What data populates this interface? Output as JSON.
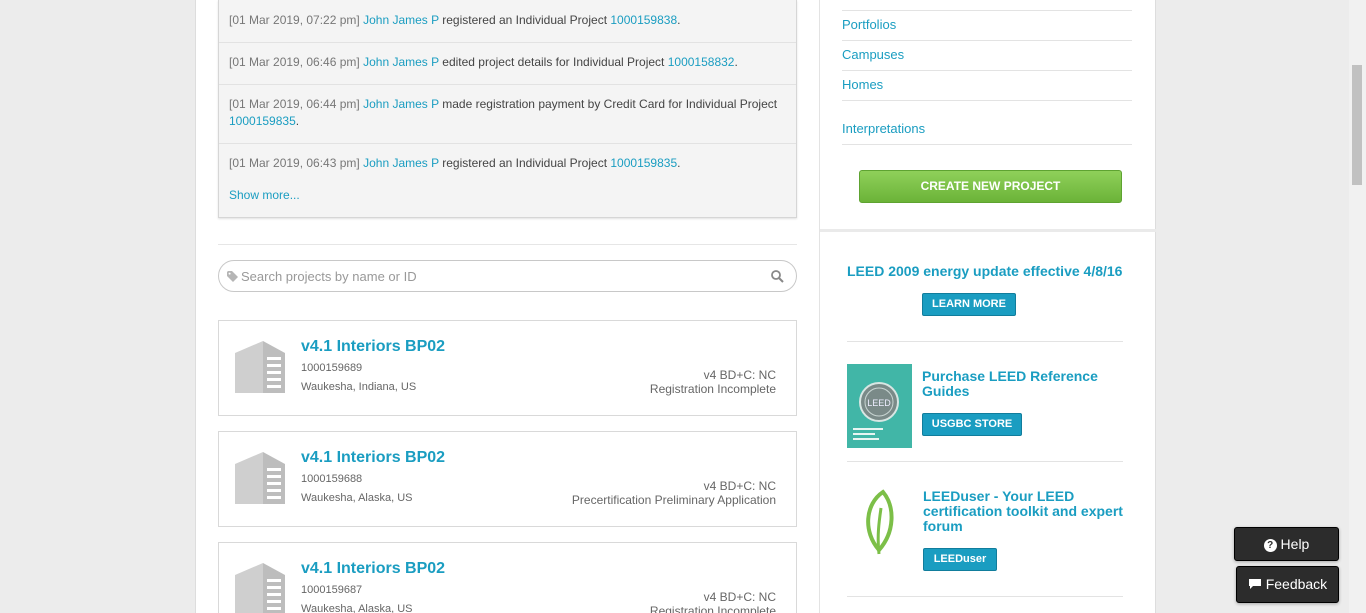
{
  "activity": {
    "items": [
      {
        "date": "[01 Mar 2019, 07:22 pm]",
        "user": "John James P",
        "action": "registered an Individual Project",
        "project": "1000159838",
        "suffix": "."
      },
      {
        "date": "[01 Mar 2019, 06:46 pm]",
        "user": "John James P",
        "action": "edited project details for Individual Project",
        "project": "1000158832",
        "suffix": "."
      },
      {
        "date": "[01 Mar 2019, 06:44 pm]",
        "user": "John James P",
        "action": "made registration payment by Credit Card for Individual Project",
        "project": "1000159835",
        "suffix": "."
      },
      {
        "date": "[01 Mar 2019, 06:43 pm]",
        "user": "John James P",
        "action": "registered an Individual Project",
        "project": "1000159835",
        "suffix": "."
      }
    ],
    "show_more": "Show more..."
  },
  "search": {
    "placeholder": "Search projects by name or ID"
  },
  "projects": [
    {
      "name": "v4.1 Interiors BP02",
      "id": "1000159689",
      "location": "Waukesha, Indiana, US",
      "rating": "v4 BD+C: NC",
      "status": "Registration Incomplete"
    },
    {
      "name": "v4.1 Interiors BP02",
      "id": "1000159688",
      "location": "Waukesha, Alaska, US",
      "rating": "v4 BD+C: NC",
      "status": "Precertification Preliminary Application"
    },
    {
      "name": "v4.1 Interiors BP02",
      "id": "1000159687",
      "location": "Waukesha, Alaska, US",
      "rating": "v4 BD+C: NC",
      "status": "Registration Incomplete"
    }
  ],
  "sidebar": {
    "links": [
      "Portfolios",
      "Campuses",
      "Homes",
      "Interpretations"
    ],
    "create_button": "CREATE NEW PROJECT",
    "promos": {
      "energy_title": "LEED 2009 energy update effective 4/8/16",
      "energy_button": "LEARN MORE",
      "guides_title": "Purchase LEED Reference Guides",
      "guides_button": "USGBC STORE",
      "book_text": "LEED",
      "leeduser_title": "LEEDuser - Your LEED certification toolkit and expert forum",
      "leeduser_button": "LEEDuser"
    }
  },
  "widgets": {
    "help": "Help",
    "feedback": "Feedback"
  },
  "colors": {
    "link": "#1a9dc1",
    "create_green": "#7ac143",
    "dark_widget": "#2c2c2c"
  }
}
